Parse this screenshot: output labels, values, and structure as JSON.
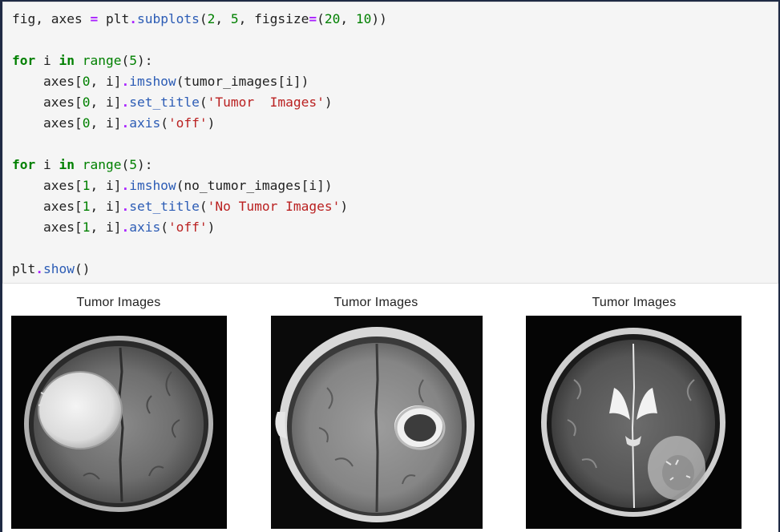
{
  "code_cell": {
    "lines": [
      [
        {
          "t": "fig, axes "
        },
        {
          "t": "=",
          "c": "op"
        },
        {
          "t": " plt"
        },
        {
          "t": ".",
          "c": "op"
        },
        {
          "t": "subplots",
          "c": "attr"
        },
        {
          "t": "("
        },
        {
          "t": "2",
          "c": "num"
        },
        {
          "t": ", "
        },
        {
          "t": "5",
          "c": "num"
        },
        {
          "t": ", figsize"
        },
        {
          "t": "=",
          "c": "op"
        },
        {
          "t": "("
        },
        {
          "t": "20",
          "c": "num"
        },
        {
          "t": ", "
        },
        {
          "t": "10",
          "c": "num"
        },
        {
          "t": "))"
        }
      ],
      [],
      [
        {
          "t": "for",
          "c": "kw"
        },
        {
          "t": " i "
        },
        {
          "t": "in",
          "c": "kw"
        },
        {
          "t": " "
        },
        {
          "t": "range",
          "c": "bi"
        },
        {
          "t": "("
        },
        {
          "t": "5",
          "c": "num"
        },
        {
          "t": "):"
        }
      ],
      [
        {
          "t": "    axes["
        },
        {
          "t": "0",
          "c": "num"
        },
        {
          "t": ", i]"
        },
        {
          "t": ".",
          "c": "op"
        },
        {
          "t": "imshow",
          "c": "attr"
        },
        {
          "t": "(tumor_images[i])"
        }
      ],
      [
        {
          "t": "    axes["
        },
        {
          "t": "0",
          "c": "num"
        },
        {
          "t": ", i]"
        },
        {
          "t": ".",
          "c": "op"
        },
        {
          "t": "set_title",
          "c": "attr"
        },
        {
          "t": "("
        },
        {
          "t": "'Tumor  Images'",
          "c": "str"
        },
        {
          "t": ")"
        }
      ],
      [
        {
          "t": "    axes["
        },
        {
          "t": "0",
          "c": "num"
        },
        {
          "t": ", i]"
        },
        {
          "t": ".",
          "c": "op"
        },
        {
          "t": "axis",
          "c": "attr"
        },
        {
          "t": "("
        },
        {
          "t": "'off'",
          "c": "str"
        },
        {
          "t": ")"
        }
      ],
      [],
      [
        {
          "t": "for",
          "c": "kw"
        },
        {
          "t": " i "
        },
        {
          "t": "in",
          "c": "kw"
        },
        {
          "t": " "
        },
        {
          "t": "range",
          "c": "bi"
        },
        {
          "t": "("
        },
        {
          "t": "5",
          "c": "num"
        },
        {
          "t": "):"
        }
      ],
      [
        {
          "t": "    axes["
        },
        {
          "t": "1",
          "c": "num"
        },
        {
          "t": ", i]"
        },
        {
          "t": ".",
          "c": "op"
        },
        {
          "t": "imshow",
          "c": "attr"
        },
        {
          "t": "(no_tumor_images[i])"
        }
      ],
      [
        {
          "t": "    axes["
        },
        {
          "t": "1",
          "c": "num"
        },
        {
          "t": ", i]"
        },
        {
          "t": ".",
          "c": "op"
        },
        {
          "t": "set_title",
          "c": "attr"
        },
        {
          "t": "("
        },
        {
          "t": "'No Tumor Images'",
          "c": "str"
        },
        {
          "t": ")"
        }
      ],
      [
        {
          "t": "    axes["
        },
        {
          "t": "1",
          "c": "num"
        },
        {
          "t": ", i]"
        },
        {
          "t": ".",
          "c": "op"
        },
        {
          "t": "axis",
          "c": "attr"
        },
        {
          "t": "("
        },
        {
          "t": "'off'",
          "c": "str"
        },
        {
          "t": ")"
        }
      ],
      [],
      [
        {
          "t": "plt"
        },
        {
          "t": ".",
          "c": "op"
        },
        {
          "t": "show",
          "c": "attr"
        },
        {
          "t": "()"
        }
      ]
    ]
  },
  "output": {
    "panels": [
      {
        "title": "Tumor  Images",
        "image": "mri-axial-large-bright-left-tumor"
      },
      {
        "title": "Tumor  Images",
        "image": "mri-axial-ring-enhancing-right-lesion"
      },
      {
        "title": "Tumor  Images",
        "image": "mri-axial-t2-posterior-right-lesion"
      }
    ]
  },
  "colors": {
    "code_background": "#f5f5f5",
    "keyword": "#008000",
    "operator": "#aa22ff",
    "string": "#ba2121",
    "attribute": "#2c5cb5",
    "border": "#1f2a44"
  }
}
